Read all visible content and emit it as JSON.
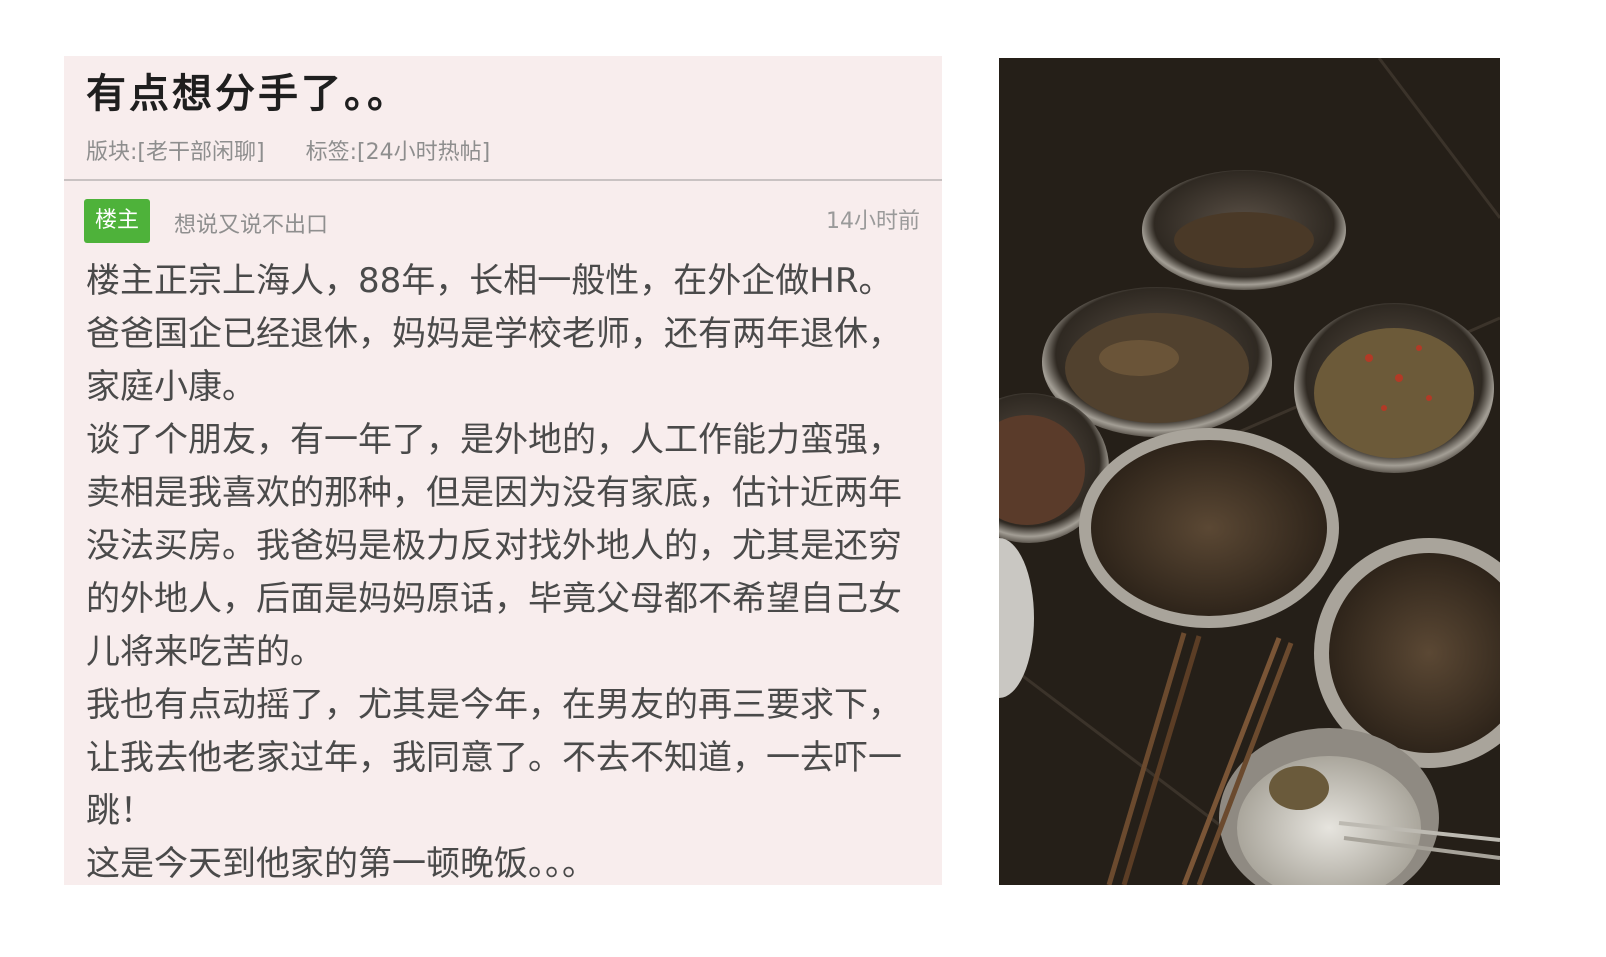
{
  "post": {
    "title": "有点想分手了。。",
    "board_label": "版块:[老干部闲聊]",
    "tag_label": "标签:[24小时热帖]",
    "op_badge": "楼主",
    "author_name": "想说又说不出口",
    "time_ago": "14小时前",
    "paragraphs": [
      "楼主正宗上海人，88年，长相一般性，在外企做HR。爸爸国企已经退休，妈妈是学校老师，还有两年退休，家庭小康。",
      "谈了个朋友，有一年了，是外地的，人工作能力蛮强，卖相是我喜欢的那种，但是因为没有家底，估计近两年没法买房。我爸妈是极力反对找外地人的，尤其是还穷的外地人，后面是妈妈原话，毕竟父母都不希望自己女儿将来吃苦的。",
      "我也有点动摇了，尤其是今年，在男友的再三要求下，让我去他老家过年，我同意了。不去不知道，一去吓一跳！",
      "这是今天到他家的第一顿晚饭。。。"
    ]
  },
  "photo": {
    "subject": "dinner-table-photo",
    "colors": {
      "table": "#2a241d",
      "metal": "#9a958c",
      "food": "#4a3a2a",
      "rice": "#d8d6d0"
    }
  }
}
